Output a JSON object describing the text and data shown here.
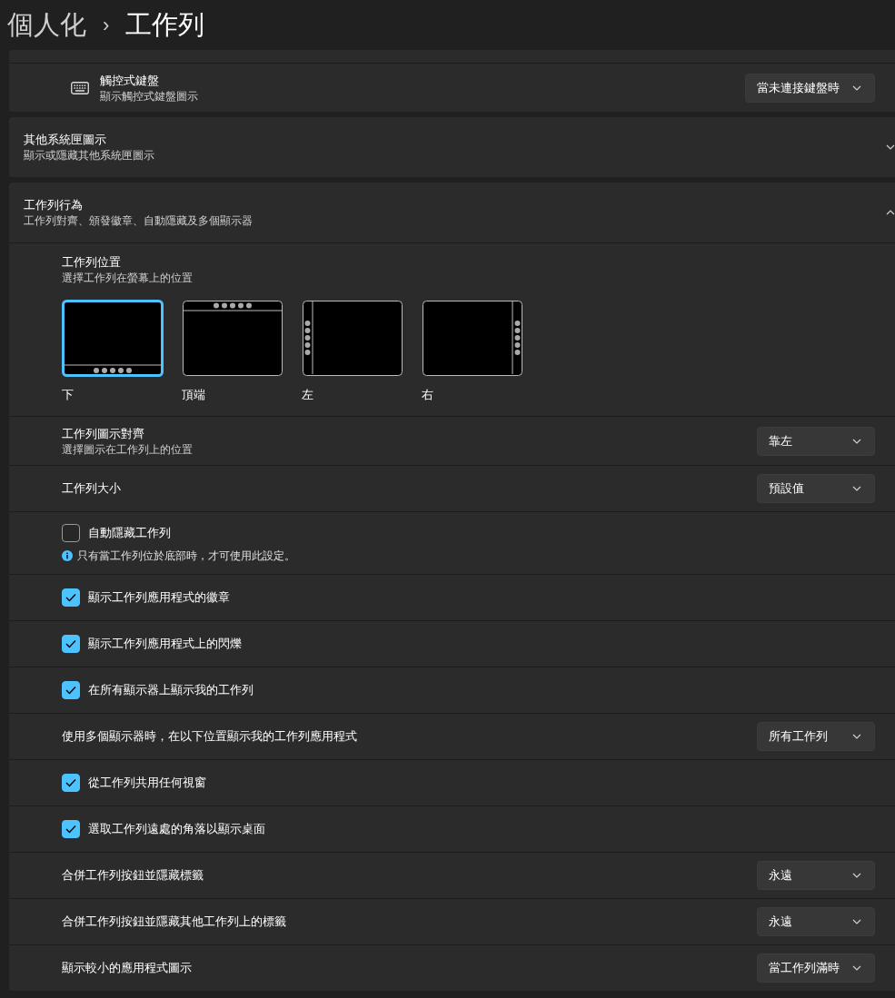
{
  "breadcrumb": {
    "parent": "個人化",
    "separator": "›",
    "current": "工作列"
  },
  "keyboard_row": {
    "title": "觸控式鍵盤",
    "description": "顯示觸控式鍵盤圖示",
    "dropdown": "當未連接鍵盤時"
  },
  "sections": [
    {
      "title": "其他系統匣圖示",
      "description": "顯示或隱藏其他系統匣圖示",
      "expanded": false
    },
    {
      "title": "工作列行為",
      "description": "工作列對齊、頒發徽章、自動隱藏及多個顯示器",
      "expanded": true,
      "rows": [
        {
          "kind": "positions",
          "title": "工作列位置",
          "description": "選擇工作列在螢幕上的位置",
          "options": [
            {
              "label": "下",
              "kind": "bottom",
              "selected": true
            },
            {
              "label": "頂端",
              "kind": "top",
              "selected": false
            },
            {
              "label": "左",
              "kind": "left",
              "selected": false
            },
            {
              "label": "右",
              "kind": "right",
              "selected": false
            }
          ]
        },
        {
          "kind": "dropdown",
          "title": "工作列圖示對齊",
          "description": "選擇圖示在工作列上的位置",
          "value": "靠左"
        },
        {
          "kind": "dropdown",
          "title": "工作列大小",
          "value": "預設值"
        },
        {
          "kind": "checkbox",
          "label": "自動隱藏工作列",
          "checked": false,
          "note": "只有當工作列位於底部時，才可使用此設定。"
        },
        {
          "kind": "checkbox",
          "label": "顯示工作列應用程式的徽章",
          "checked": true
        },
        {
          "kind": "checkbox",
          "label": "顯示工作列應用程式上的閃爍",
          "checked": true
        },
        {
          "kind": "checkbox",
          "label": "在所有顯示器上顯示我的工作列",
          "checked": true
        },
        {
          "kind": "dropdown",
          "title": "使用多個顯示器時，在以下位置顯示我的工作列應用程式",
          "value": "所有工作列"
        },
        {
          "kind": "checkbox",
          "label": "從工作列共用任何視窗",
          "checked": true
        },
        {
          "kind": "checkbox",
          "label": "選取工作列遠處的角落以顯示桌面",
          "checked": true
        },
        {
          "kind": "dropdown",
          "title": "合併工作列按鈕並隱藏標籤",
          "value": "永遠"
        },
        {
          "kind": "dropdown",
          "title": "合併工作列按鈕並隱藏其他工作列上的標籤",
          "value": "永遠"
        },
        {
          "kind": "dropdown",
          "title": "顯示較小的應用程式圖示",
          "value": "當工作列滿時"
        }
      ]
    }
  ]
}
